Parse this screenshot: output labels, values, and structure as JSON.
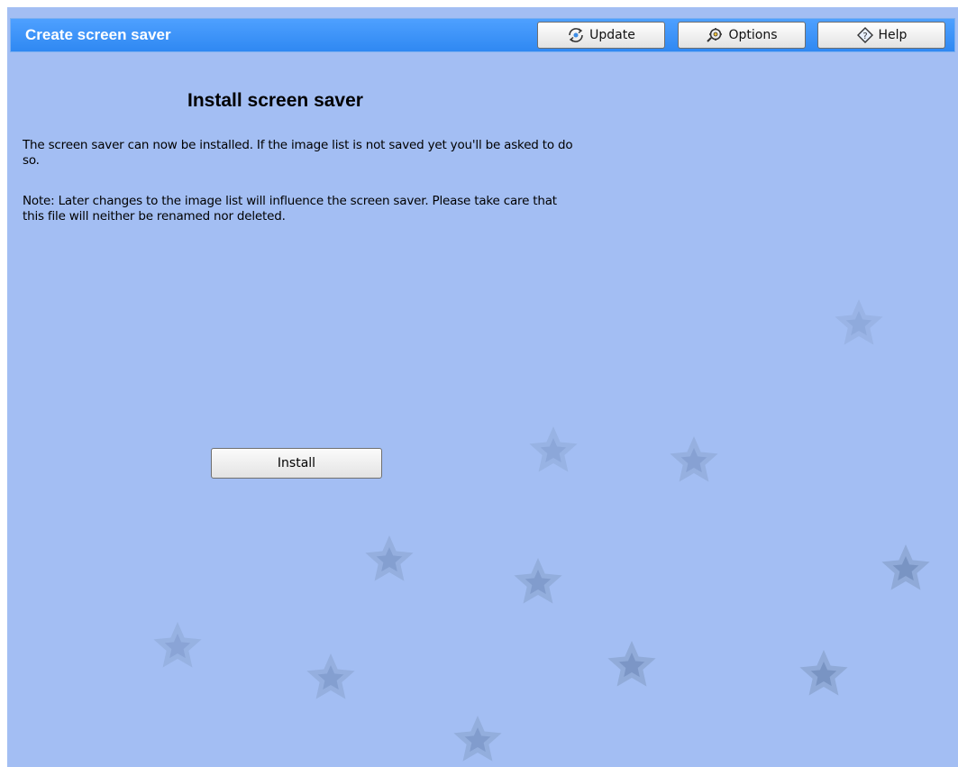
{
  "header": {
    "title": "Create screen saver",
    "buttons": {
      "update": "Update",
      "options": "Options",
      "help": "Help"
    }
  },
  "main": {
    "heading": "Install screen saver",
    "paragraph1": "The screen saver can now be installed. If the image list is not saved yet you'll be asked to do so.",
    "paragraph2": "Note: Later changes to the image list will influence the screen saver. Please take care that this file will neither be renamed nor deleted.",
    "install_label": "Install"
  },
  "colors": {
    "background": "#a3bef3",
    "titlebar": "#3a90f8",
    "star": "#8aa4cf"
  },
  "icons": {
    "update": "update-icon",
    "options": "options-icon",
    "help": "help-icon",
    "background_decoration": "star-icon"
  }
}
